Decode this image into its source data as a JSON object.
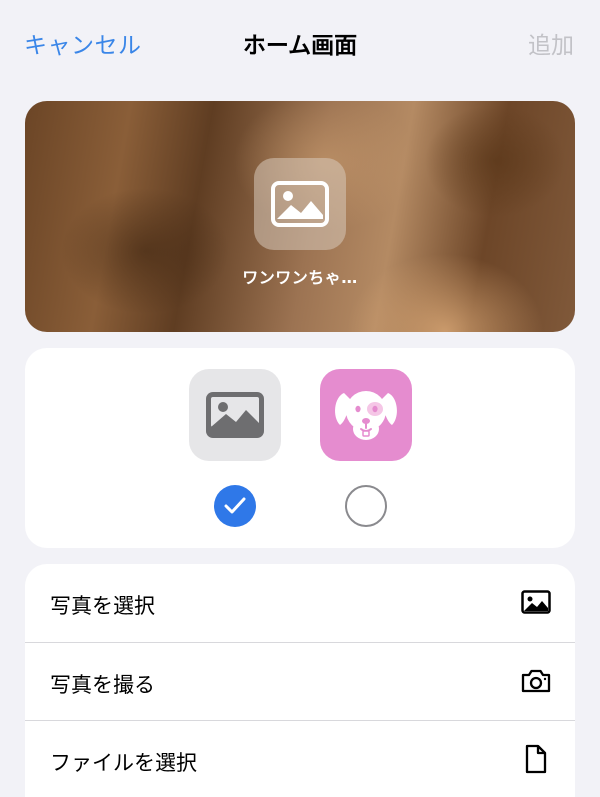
{
  "nav": {
    "cancel_label": "キャンセル",
    "title": "ホーム画面",
    "add_label": "追加"
  },
  "preview": {
    "app_label": "ワンワンちゃ…",
    "icon": "photo-placeholder-icon"
  },
  "icon_choices": [
    {
      "icon": "photo-placeholder-icon",
      "selected": true
    },
    {
      "icon": "dog-face-icon",
      "selected": false
    }
  ],
  "actions": [
    {
      "label": "写真を選択",
      "icon": "photo-icon"
    },
    {
      "label": "写真を撮る",
      "icon": "camera-icon"
    },
    {
      "label": "ファイルを選択",
      "icon": "document-icon"
    }
  ],
  "colors": {
    "accent": "#2f78e8",
    "disabled": "#c2c2c7",
    "background": "#f2f2f7",
    "dog_icon_bg": "#e58ccf"
  }
}
